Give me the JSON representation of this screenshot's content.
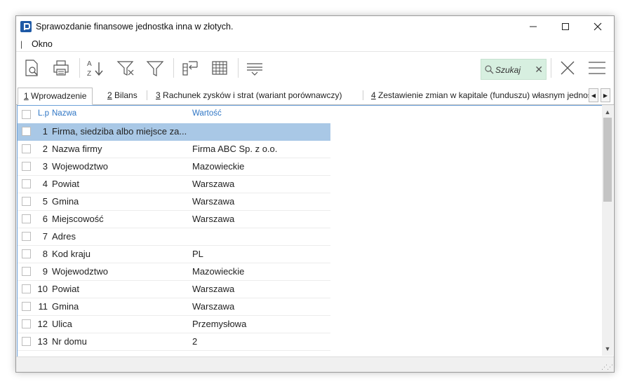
{
  "window": {
    "title": "Sprawozdanie finansowe jednostka inna w złotych.",
    "minimize": "—",
    "maximize": "☐",
    "close": "✕"
  },
  "menu": {
    "grip": "|",
    "items": [
      "Okno"
    ]
  },
  "toolbar": {
    "icons": [
      "print-preview-icon",
      "print-icon",
      "sort-az-icon",
      "filter-clear-icon",
      "filter-icon",
      "column-reorder-icon",
      "grid-icon",
      "lines-icon",
      "close-x-icon",
      "hamburger-menu-icon"
    ],
    "search_placeholder": "Szukaj",
    "search_clear": "✕"
  },
  "tabs": [
    {
      "num": "1",
      "label": " Wprowadzenie"
    },
    {
      "num": "2",
      "label": " Bilans"
    },
    {
      "num": "3",
      "label": " Rachunek zysków i strat (wariant porównawczy)"
    },
    {
      "num": "4",
      "label": " Zestawienie zmian w kapitale (funduszu) własnym jednos"
    }
  ],
  "tab_nav": {
    "left": "◀",
    "right": "▶"
  },
  "table": {
    "headers": {
      "lp": "L.p",
      "name": "Nazwa",
      "value": "Wartość"
    },
    "rows": [
      {
        "lp": "1",
        "name": "Firma, siedziba albo miejsce za...",
        "value": ""
      },
      {
        "lp": "2",
        "name": "Nazwa firmy",
        "value": "Firma ABC Sp. z o.o."
      },
      {
        "lp": "3",
        "name": "Wojewodztwo",
        "value": "Mazowieckie"
      },
      {
        "lp": "4",
        "name": "Powiat",
        "value": "Warszawa"
      },
      {
        "lp": "5",
        "name": "Gmina",
        "value": "Warszawa"
      },
      {
        "lp": "6",
        "name": "Miejscowość",
        "value": "Warszawa"
      },
      {
        "lp": "7",
        "name": "Adres",
        "value": ""
      },
      {
        "lp": "8",
        "name": "Kod kraju",
        "value": "PL"
      },
      {
        "lp": "9",
        "name": "Wojewodztwo",
        "value": "Mazowieckie"
      },
      {
        "lp": "10",
        "name": "Powiat",
        "value": "Warszawa"
      },
      {
        "lp": "11",
        "name": "Gmina",
        "value": "Warszawa"
      },
      {
        "lp": "12",
        "name": "Ulica",
        "value": "Przemysłowa"
      },
      {
        "lp": "13",
        "name": "Nr domu",
        "value": "2"
      }
    ]
  },
  "scrollbar": {
    "up": "▲",
    "down": "▼"
  },
  "colors": {
    "selection": "#a9c8e6",
    "search_bg": "#d7efe0",
    "header_text": "#2f76c5",
    "app_icon": "#1f5aa6"
  }
}
